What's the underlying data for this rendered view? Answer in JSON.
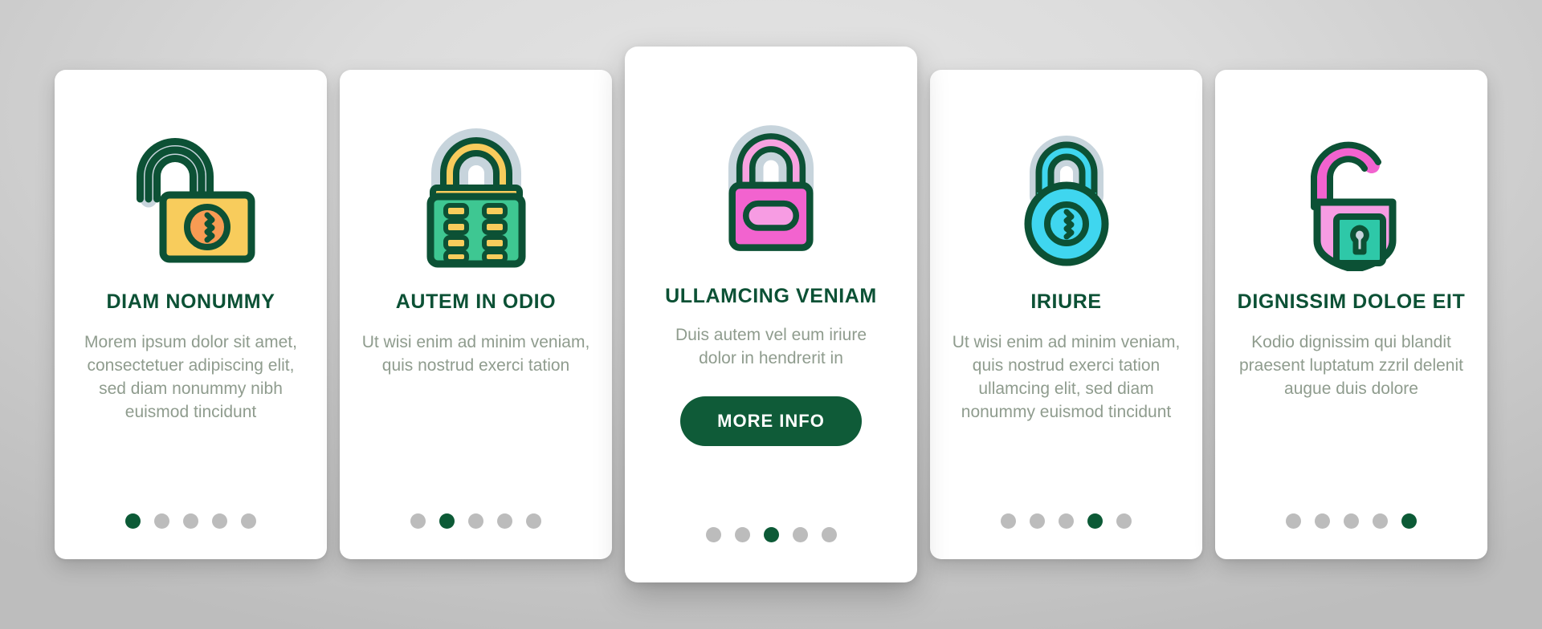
{
  "theme": {
    "brand_green": "#0c5135",
    "button_green": "#0f5b38",
    "dot_active": "#0c5a36",
    "dot_inactive": "#bcbcbc",
    "body_text": "#8f9c8e",
    "card_bg": "#ffffff",
    "page_bg": "#dcdcdc"
  },
  "cards": [
    {
      "icon_name": "open-padlock-orange-icon",
      "title": "DIAM NONUMMY",
      "description": "Morem ipsum dolor sit amet, consectetuer adipiscing elit, sed diam nonummy nibh euismod tincidunt",
      "featured": false,
      "dots": {
        "count": 5,
        "active_index": 0
      }
    },
    {
      "icon_name": "combination-padlock-green-icon",
      "title": "AUTEM IN ODIO",
      "description": "Ut wisi enim ad minim veniam, quis nostrud exerci tation",
      "featured": false,
      "dots": {
        "count": 5,
        "active_index": 1
      }
    },
    {
      "icon_name": "closed-padlock-pink-icon",
      "title": "ULLAMCING VENIAM",
      "description": "Duis autem vel eum iriure dolor in hendrerit in",
      "button_label": "MORE INFO",
      "featured": true,
      "dots": {
        "count": 5,
        "active_index": 2
      }
    },
    {
      "icon_name": "round-padlock-cyan-icon",
      "title": "IRIURE",
      "description": "Ut wisi enim ad minim veniam, quis nostrud exerci tation ullamcing elit, sed diam nonummy euismod tincidunt",
      "featured": false,
      "dots": {
        "count": 5,
        "active_index": 3
      }
    },
    {
      "icon_name": "unlocked-shield-padlock-pink-icon",
      "title": "DIGNISSIM DOLOE EIT",
      "description": "Kodio dignissim qui blandit praesent luptatum zzril delenit augue duis dolore",
      "featured": false,
      "dots": {
        "count": 5,
        "active_index": 4
      }
    }
  ]
}
